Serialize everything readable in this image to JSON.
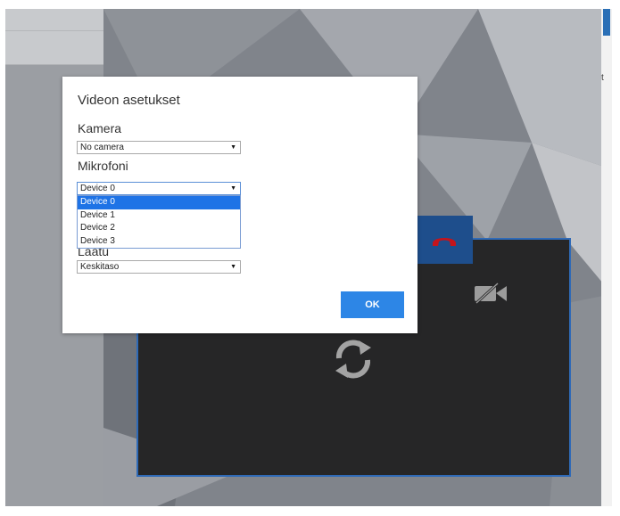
{
  "dialog": {
    "title": "Videon asetukset",
    "camera_label": "Kamera",
    "camera_value": "No camera",
    "mic_label": "Mikrofoni",
    "mic_value": "Device 0",
    "mic_options": [
      "Device 0",
      "Device 1",
      "Device 2",
      "Device 3"
    ],
    "mic_selected_index": 0,
    "quality_label": "Laatu",
    "quality_value": "Keskitaso",
    "ok_label": "OK"
  },
  "icons": {
    "hangup": "phone-hangup-icon",
    "camera_off": "camera-off-icon",
    "refresh": "refresh-icon",
    "dropdown_arrow": "chevron-down-icon"
  },
  "colors": {
    "accent": "#2d86e6",
    "hangup_red": "#c4141b",
    "video_bg": "#262627",
    "panel_border": "#2f6ab7"
  }
}
